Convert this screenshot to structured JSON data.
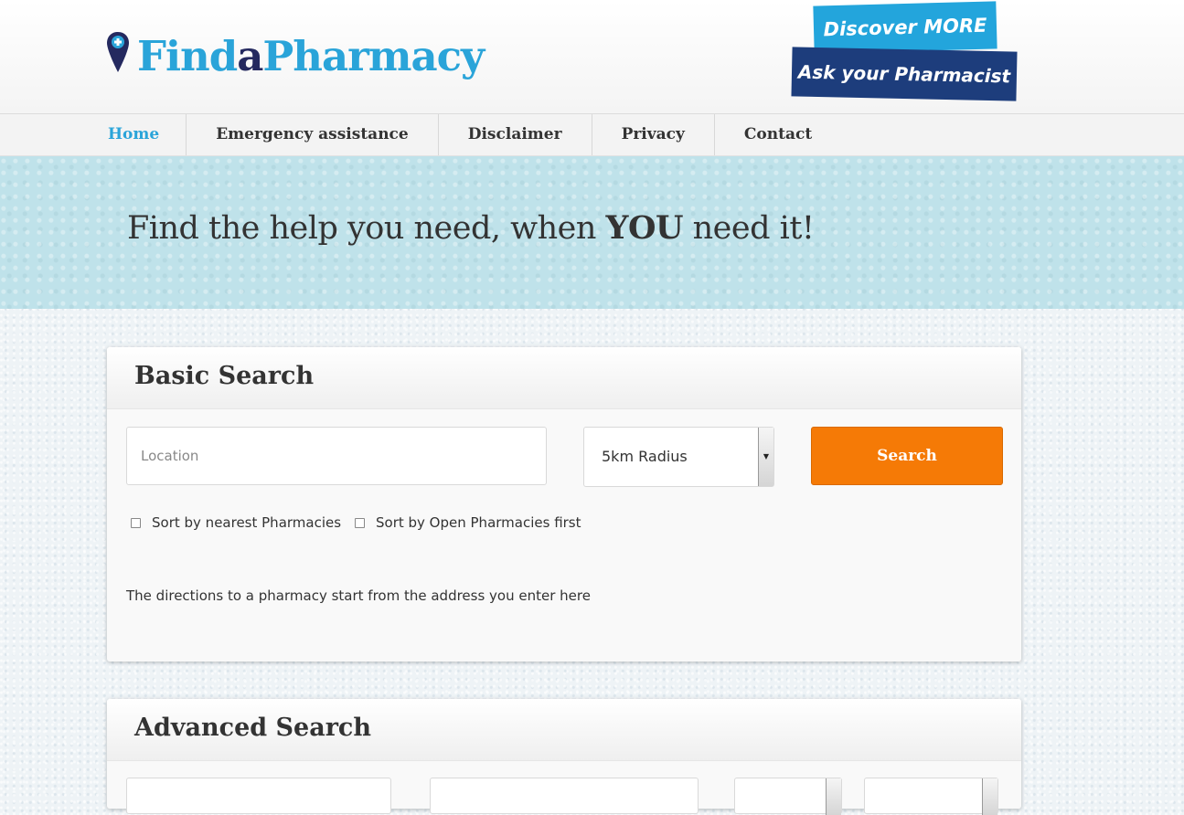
{
  "header": {
    "logo": {
      "find": "Find",
      "a": "a",
      "pharmacy": "Pharmacy"
    },
    "promo": {
      "line1": "Discover MORE",
      "line2": "Ask your Pharmacist"
    }
  },
  "nav": {
    "items": [
      {
        "label": "Home",
        "active": true
      },
      {
        "label": "Emergency assistance"
      },
      {
        "label": "Disclaimer"
      },
      {
        "label": "Privacy"
      },
      {
        "label": "Contact"
      }
    ]
  },
  "hero": {
    "text_before": "Find the help you need, when ",
    "text_emphasis": "YOU",
    "text_after": " need it!"
  },
  "basic_search": {
    "title": "Basic Search",
    "location_placeholder": "Location",
    "radius_selected": "5km Radius",
    "search_label": "Search",
    "sort_nearest_label": "Sort by nearest Pharmacies",
    "sort_open_label": "Sort by Open Pharmacies first",
    "directions_note": "The directions to a pharmacy start from the address you enter here"
  },
  "advanced_search": {
    "title": "Advanced Search"
  },
  "colors": {
    "brand_blue": "#2aa4d9",
    "brand_navy": "#24295f",
    "search_orange": "#f57a06"
  }
}
